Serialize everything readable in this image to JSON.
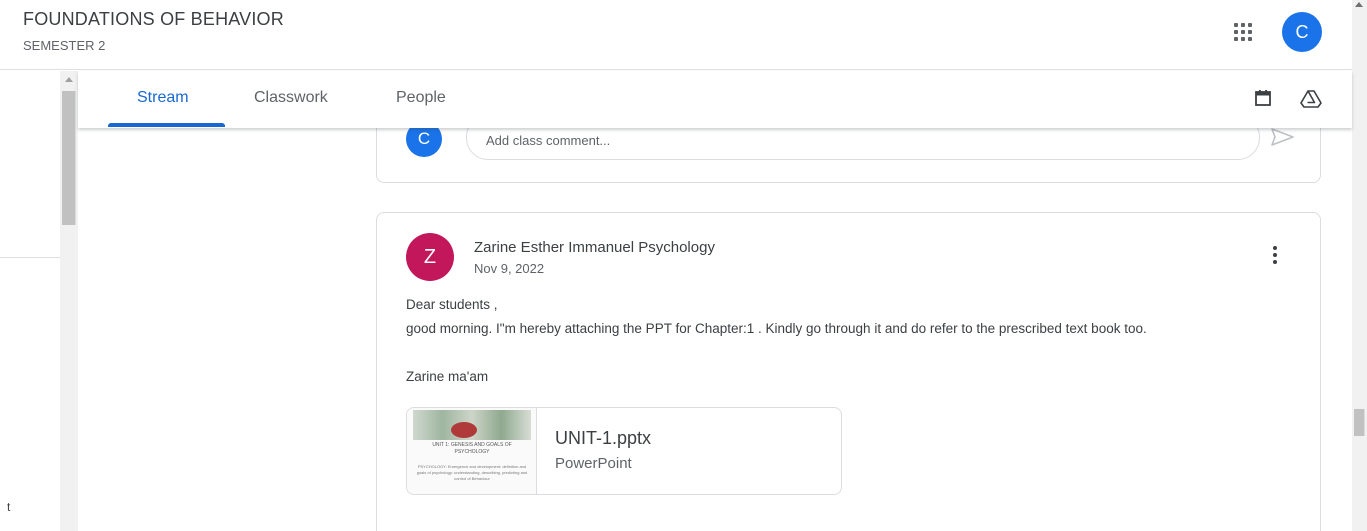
{
  "header": {
    "class_title": "FOUNDATIONS OF BEHAVIOR",
    "class_subtitle": "SEMESTER 2",
    "account_initial": "C"
  },
  "tabs": [
    {
      "label": "Stream",
      "active": true
    },
    {
      "label": "Classwork",
      "active": false
    },
    {
      "label": "People",
      "active": false
    }
  ],
  "left_panel": {
    "letter": "t"
  },
  "comment": {
    "avatar_initial": "C",
    "placeholder": "Add class comment..."
  },
  "post": {
    "avatar_initial": "Z",
    "avatar_color": "#c2185b",
    "author": "Zarine Esther Immanuel Psychology",
    "date": "Nov 9, 2022",
    "body": {
      "line1": "Dear students ,",
      "line2": "good morning. I\"m hereby attaching the PPT for Chapter:1 . Kindly go through it and do refer to the prescribed text book too.",
      "line3": "Zarine ma'am"
    },
    "attachment": {
      "title": "UNIT-1.pptx",
      "type": "PowerPoint",
      "thumb_heading": "UNIT 1: GENESIS AND GOALS OF PSYCHOLOGY",
      "thumb_text": "PSYCHOLOGY: Emergence and development; definition and goals of psychology: understanding, describing, predicting and control of Behaviour"
    }
  },
  "colors": {
    "accent": "#1967d2",
    "avatar_blue": "#1a73e8"
  }
}
